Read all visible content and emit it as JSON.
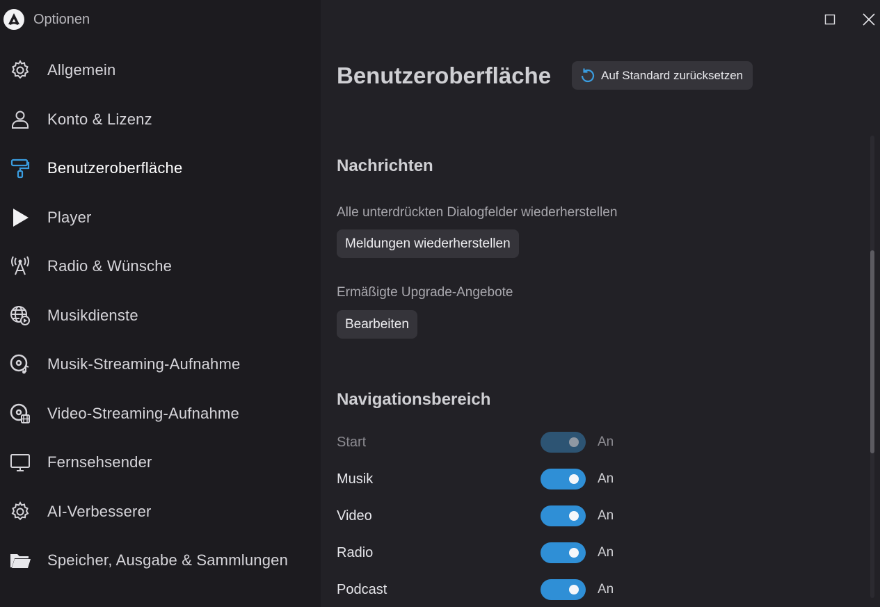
{
  "app": {
    "title": "Optionen",
    "logo_icon": "app-logo-icon"
  },
  "sidebar": {
    "items": [
      {
        "label": "Allgemein",
        "icon": "gear-icon",
        "active": false
      },
      {
        "label": "Konto & Lizenz",
        "icon": "user-icon",
        "active": false
      },
      {
        "label": "Benutzeroberfläche",
        "icon": "paint-roller-icon",
        "active": true
      },
      {
        "label": "Player",
        "icon": "play-icon",
        "active": false
      },
      {
        "label": "Radio & Wünsche",
        "icon": "radio-tower-icon",
        "active": false
      },
      {
        "label": "Musikdienste",
        "icon": "globe-play-icon",
        "active": false
      },
      {
        "label": "Musik-Streaming-Aufnahme",
        "icon": "disc-music-icon",
        "active": false
      },
      {
        "label": "Video-Streaming-Aufnahme",
        "icon": "disc-film-icon",
        "active": false
      },
      {
        "label": "Fernsehsender",
        "icon": "monitor-icon",
        "active": false
      },
      {
        "label": "AI-Verbesserer",
        "icon": "gear-icon",
        "active": false
      },
      {
        "label": "Speicher, Ausgabe & Sammlungen",
        "icon": "folder-icon",
        "active": false
      }
    ]
  },
  "main": {
    "title": "Benutzeroberfläche",
    "reset_label": "Auf Standard zurücksetzen",
    "messages": {
      "title": "Nachrichten",
      "restore_desc": "Alle unterdrückten Dialogfelder wiederherstellen",
      "restore_button": "Meldungen wiederherstellen",
      "upgrade_desc": "Ermäßigte Upgrade-Angebote",
      "edit_button": "Bearbeiten"
    },
    "navigation": {
      "title": "Navigationsbereich",
      "items": [
        {
          "label": "Start",
          "state": "An",
          "on": true,
          "disabled": true
        },
        {
          "label": "Musik",
          "state": "An",
          "on": true,
          "disabled": false
        },
        {
          "label": "Video",
          "state": "An",
          "on": true,
          "disabled": false
        },
        {
          "label": "Radio",
          "state": "An",
          "on": true,
          "disabled": false
        },
        {
          "label": "Podcast",
          "state": "An",
          "on": true,
          "disabled": false
        }
      ]
    }
  },
  "colors": {
    "accent": "#2f8fd6",
    "sidebar_bg": "#1c1b1f",
    "main_bg": "#222126"
  }
}
